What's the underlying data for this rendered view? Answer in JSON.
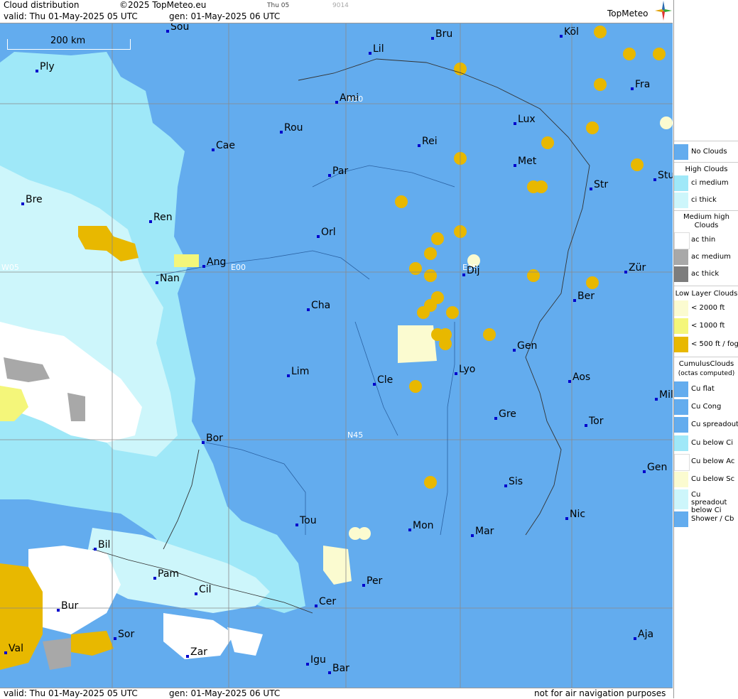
{
  "header": {
    "title": "Cloud distribution",
    "copyright": "©2025 TopMeteo.eu",
    "day_small": "Thu 05",
    "code_small": "9014",
    "valid": "valid:  Thu  01-May-2025  05 UTC",
    "gen": "gen: 01-May-2025 06 UTC",
    "logo": "TopMeteo"
  },
  "map": {
    "scale_label": "200 km",
    "grid_labels": {
      "n50": "N50",
      "n45": "N45",
      "w05": "W05",
      "e00": "E00",
      "e05": "E05"
    },
    "cities": [
      "Sou",
      "Bru",
      "Köl",
      "Lil",
      "Ply",
      "Ami",
      "Fra",
      "Lux",
      "Rou",
      "Cae",
      "Rei",
      "Met",
      "Par",
      "Stu",
      "Str",
      "Bre",
      "Ren",
      "Orl",
      "Ang",
      "Nan",
      "Dij",
      "Zür",
      "Ber",
      "Cha",
      "Gen",
      "Lim",
      "Cle",
      "Lyo",
      "Aos",
      "Mil",
      "Gre",
      "Tor",
      "Bor",
      "Sis",
      "Gen",
      "Nic",
      "Tou",
      "Mon",
      "Mar",
      "Bil",
      "Pam",
      "Cil",
      "Bur",
      "Per",
      "Cer",
      "Sor",
      "Aja",
      "Val",
      "Zar",
      "Igu",
      "Bar"
    ]
  },
  "footer": {
    "valid": "valid:  Thu  01-May-2025  05 UTC",
    "gen": "gen: 01-May-2025 06 UTC",
    "disclaimer": "not for air navigation purposes"
  },
  "legend": {
    "no_clouds": "No Clouds",
    "high_title": "High Clouds",
    "high_items": [
      "ci medium",
      "ci thick"
    ],
    "medium_title": "Medium high Clouds",
    "medium_items": [
      "ac thin",
      "ac medium",
      "ac thick"
    ],
    "low_title": "Low Layer Clouds",
    "low_items": [
      "< 2000 ft",
      "< 1000 ft",
      "< 500 ft / fog"
    ],
    "cumulus_title": "CumulusClouds",
    "cumulus_subtitle": "(octas computed)",
    "cumulus_items": [
      "Cu flat",
      "Cu Cong",
      "Cu spreadout",
      "Cu below Ci",
      "Cu below Ac",
      "Cu below Sc",
      "Cu spreadout below Ci",
      "Shower / Cb"
    ]
  },
  "colors": {
    "no_clouds": "#63acee",
    "ci_medium": "#9fe8f8",
    "ci_thick": "#cdf6fb",
    "ac_thin": "#ffffff",
    "ac_medium": "#a8a8a8",
    "ac_thick": "#7d7d7d",
    "low_2000": "#fbfbd0",
    "low_1000": "#f4f67a",
    "low_500": "#e8b800",
    "city_marker": "#0000cc"
  }
}
